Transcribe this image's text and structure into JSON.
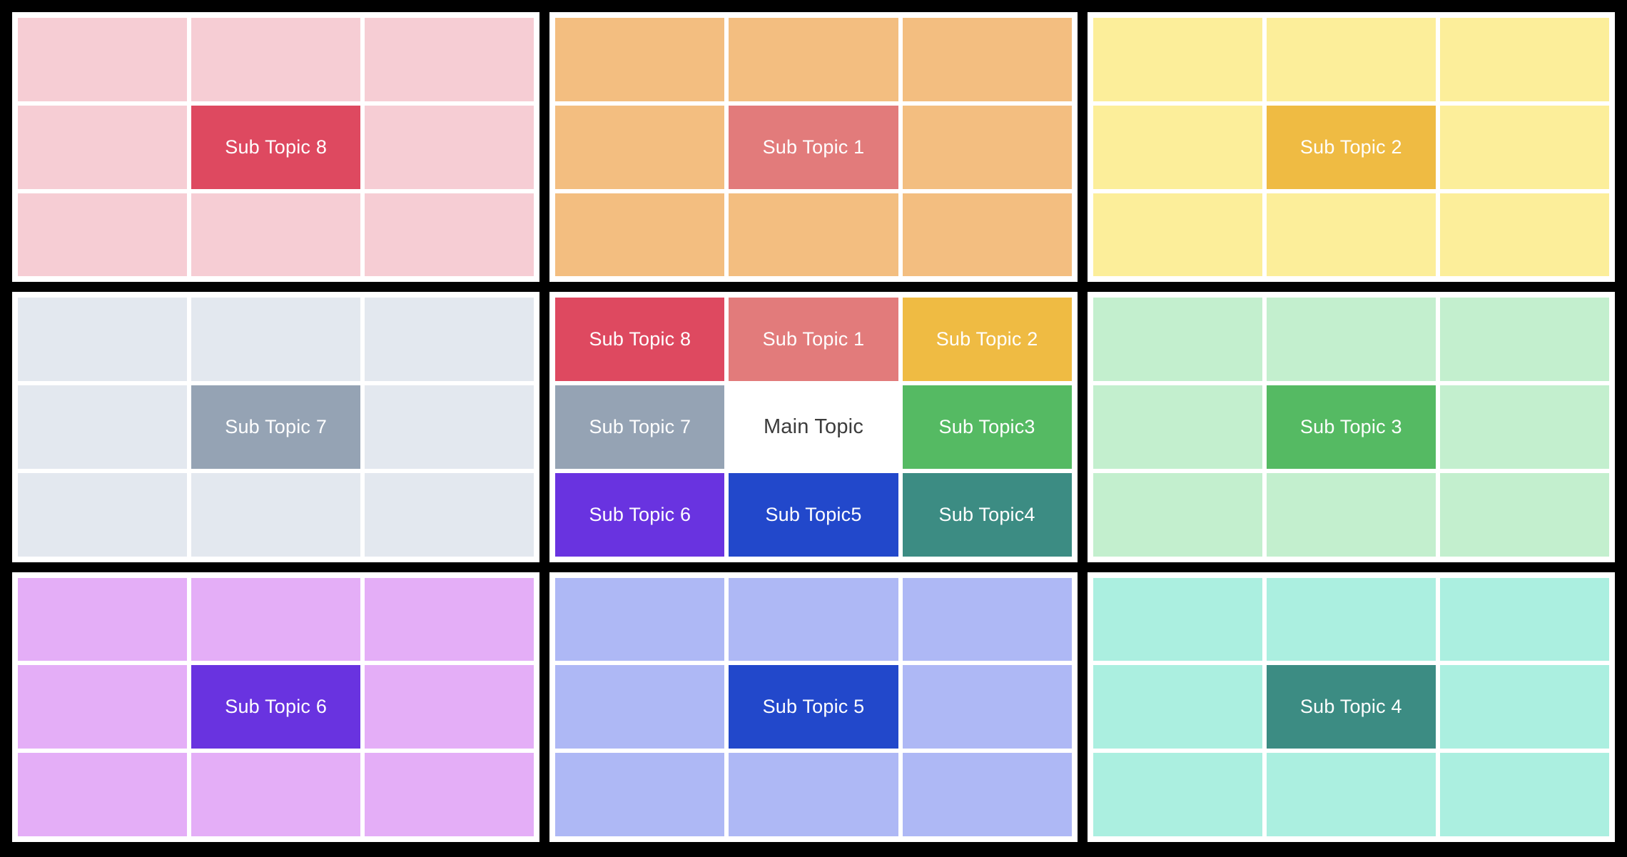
{
  "diagram": {
    "type": "lotus-blossom",
    "main_topic": "Main Topic",
    "grid_size": "3x3 panels of 3x3 cells",
    "board_background": "#000000",
    "panel_frame_color": "#ffffff"
  },
  "palette": {
    "sub1_accent": "#E27B7B",
    "sub1_light": "#F3BE80",
    "sub2_accent": "#EFBB43",
    "sub2_light": "#FCEE9A",
    "sub3_accent": "#55BA63",
    "sub3_light": "#C3EFCE",
    "sub4_accent": "#3C8C83",
    "sub4_light": "#ABEFE0",
    "sub5_accent": "#2248CB",
    "sub5_light": "#AEB8F5",
    "sub6_accent": "#6933E0",
    "sub6_light": "#E4AEF7",
    "sub7_accent": "#95A3B4",
    "sub7_light": "#E3E8EF",
    "sub8_accent": "#DE4960",
    "sub8_light": "#F6CDD4",
    "main_bg": "#FFFFFF",
    "main_text": "#3C3C3C"
  },
  "panels": [
    {
      "name": "panel-sub-topic-8",
      "position": "top-left",
      "light": "#F6CDD4",
      "accent": "#DE4960",
      "cells": [
        "",
        "",
        "",
        "",
        "Sub Topic 8",
        "",
        "",
        "",
        ""
      ]
    },
    {
      "name": "panel-sub-topic-1",
      "position": "top-center",
      "light": "#F3BE80",
      "accent": "#E27B7B",
      "cells": [
        "",
        "",
        "",
        "",
        "Sub Topic 1",
        "",
        "",
        "",
        ""
      ]
    },
    {
      "name": "panel-sub-topic-2",
      "position": "top-right",
      "light": "#FCEE9A",
      "accent": "#EFBB43",
      "cells": [
        "",
        "",
        "",
        "",
        "Sub Topic 2",
        "",
        "",
        "",
        ""
      ]
    },
    {
      "name": "panel-sub-topic-7",
      "position": "middle-left",
      "light": "#E3E8EF",
      "accent": "#95A3B4",
      "cells": [
        "",
        "",
        "",
        "",
        "Sub Topic 7",
        "",
        "",
        "",
        ""
      ]
    },
    {
      "name": "panel-main-topic",
      "position": "middle-center",
      "light": "#FFFFFF",
      "accent": "#FFFFFF",
      "cells": [
        "Sub Topic 8",
        "Sub Topic 1",
        "Sub Topic 2",
        "Sub Topic 7",
        "Main Topic",
        "Sub Topic3",
        "Sub Topic 6",
        "Sub Topic5",
        "Sub Topic4"
      ],
      "cell_colors": [
        "#DE4960",
        "#E27B7B",
        "#EFBB43",
        "#95A3B4",
        "#FFFFFF",
        "#55BA63",
        "#6933E0",
        "#2248CB",
        "#3C8C83"
      ]
    },
    {
      "name": "panel-sub-topic-3",
      "position": "middle-right",
      "light": "#C3EFCE",
      "accent": "#55BA63",
      "cells": [
        "",
        "",
        "",
        "",
        "Sub Topic 3",
        "",
        "",
        "",
        ""
      ]
    },
    {
      "name": "panel-sub-topic-6",
      "position": "bottom-left",
      "light": "#E4AEF7",
      "accent": "#6933E0",
      "cells": [
        "",
        "",
        "",
        "",
        "Sub Topic 6",
        "",
        "",
        "",
        ""
      ]
    },
    {
      "name": "panel-sub-topic-5",
      "position": "bottom-center",
      "light": "#AEB8F5",
      "accent": "#2248CB",
      "cells": [
        "",
        "",
        "",
        "",
        "Sub Topic 5",
        "",
        "",
        "",
        ""
      ]
    },
    {
      "name": "panel-sub-topic-4",
      "position": "bottom-right",
      "light": "#ABEFE0",
      "accent": "#3C8C83",
      "cells": [
        "",
        "",
        "",
        "",
        "Sub Topic 4",
        "",
        "",
        "",
        ""
      ]
    }
  ]
}
